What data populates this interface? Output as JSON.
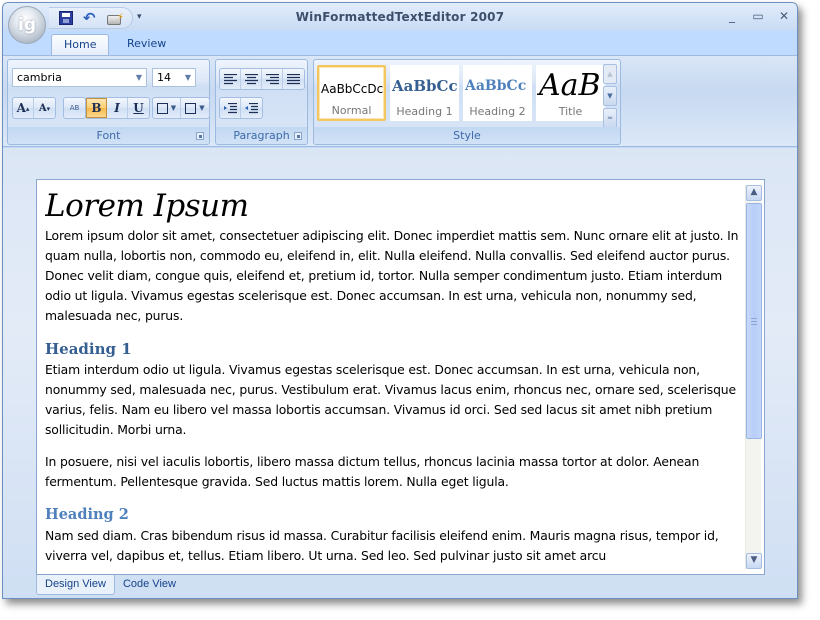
{
  "window": {
    "title": "WinFormattedTextEditor 2007",
    "app_orb_label": "ig",
    "controls": {
      "minimize": "_",
      "maximize": "▭",
      "close": "✕"
    }
  },
  "quick_access": {
    "items": [
      {
        "name": "save",
        "icon": "floppy-disk-icon"
      },
      {
        "name": "undo",
        "icon": "undo-icon"
      },
      {
        "name": "print",
        "icon": "quick-print-icon"
      }
    ],
    "more_label": "▾"
  },
  "ribbon": {
    "tabs": [
      {
        "label": "Home",
        "active": true
      },
      {
        "label": "Review",
        "active": false
      }
    ],
    "font_group": {
      "label": "Font",
      "font_name": "cambria",
      "font_size": "14",
      "grow_label": "A",
      "shrink_label": "A",
      "clear_format_label": "AB",
      "bold_label": "B",
      "italic_label": "I",
      "underline_label": "U",
      "bold_active": true
    },
    "paragraph_group": {
      "label": "Paragraph",
      "alignments": [
        "align-left",
        "align-center",
        "align-right",
        "justify"
      ],
      "indents": [
        "increase-indent",
        "decrease-indent"
      ]
    },
    "style_group": {
      "label": "Style",
      "styles": [
        {
          "sample": "AaBbCcDc",
          "name": "Normal",
          "selected": true
        },
        {
          "sample": "AaBbCc",
          "name": "Heading 1",
          "selected": false
        },
        {
          "sample": "AaBbCc",
          "name": "Heading 2",
          "selected": false
        },
        {
          "sample": "AaB",
          "name": "Title",
          "selected": false
        }
      ]
    }
  },
  "document": {
    "title": "Lorem Ipsum",
    "para1": "Lorem ipsum dolor sit amet, consectetuer adipiscing elit. Donec imperdiet mattis sem. Nunc ornare elit at justo. In quam nulla, lobortis non, commodo eu, eleifend in, elit. Nulla eleifend. Nulla convallis. Sed eleifend auctor purus. Donec velit diam, congue quis, eleifend et, pretium id, tortor. Nulla semper condimentum justo. Etiam interdum odio ut ligula. Vivamus egestas scelerisque est. Donec accumsan. In est urna, vehicula non, nonummy sed, malesuada nec, purus.",
    "heading1": "Heading 1",
    "para2": "Etiam interdum odio ut ligula. Vivamus egestas scelerisque est. Donec accumsan. In est urna, vehicula non, nonummy sed, malesuada nec, purus. Vestibulum erat. Vivamus lacus enim, rhoncus nec, ornare sed, scelerisque varius, felis. Nam eu libero vel massa lobortis accumsan. Vivamus id orci. Sed sed lacus sit amet nibh pretium sollicitudin. Morbi urna.",
    "para3": "In posuere, nisi vel iaculis lobortis, libero massa dictum tellus, rhoncus lacinia massa tortor at dolor. Aenean fermentum. Pellentesque gravida. Sed luctus mattis lorem. Nulla eget ligula.",
    "heading2": "Heading 2",
    "para4": "Nam sed diam. Cras bibendum risus id massa. Curabitur facilisis eleifend enim. Mauris magna risus, tempor id, viverra vel, dapibus et, tellus. Etiam libero. Ut urna. Sed leo. Sed pulvinar justo sit amet arcu"
  },
  "view_tabs": [
    {
      "label": "Design View",
      "active": true
    },
    {
      "label": "Code View",
      "active": false
    }
  ],
  "colors": {
    "heading1": "#365f91",
    "heading2": "#4f81bd",
    "ribbon_text": "#15428b",
    "selected_style_border": "#f3c660",
    "bold_active_bg": "#fbce6f"
  }
}
